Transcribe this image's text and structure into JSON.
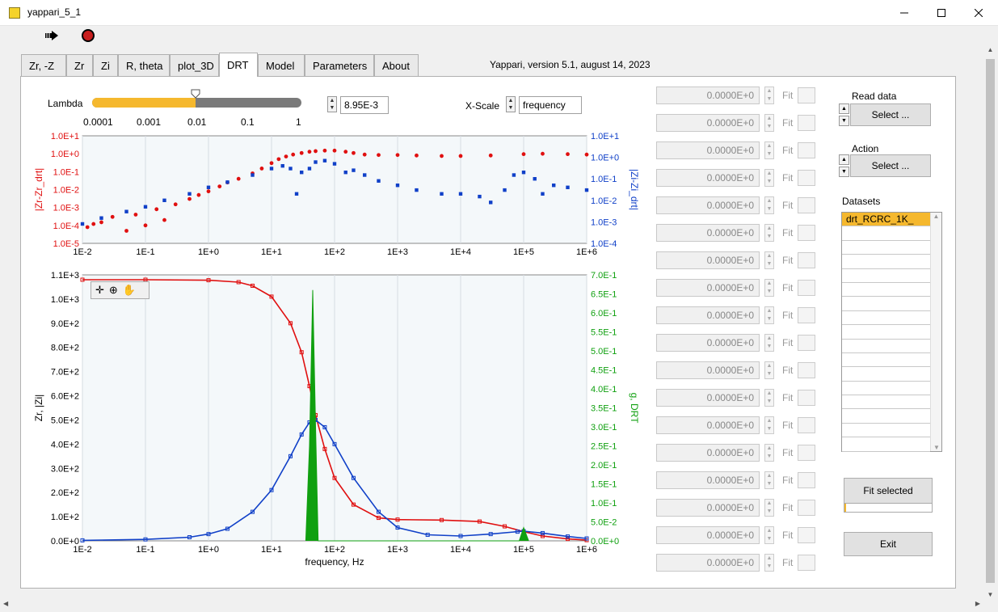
{
  "window": {
    "title": "yappari_5_1"
  },
  "tabs": [
    {
      "label": "Zr, -Z"
    },
    {
      "label": "Zr"
    },
    {
      "label": "Zi"
    },
    {
      "label": "R, theta"
    },
    {
      "label": "plot_3D"
    },
    {
      "label": "DRT"
    },
    {
      "label": "Model"
    },
    {
      "label": "Parameters"
    },
    {
      "label": "About"
    }
  ],
  "active_tab": "DRT",
  "version_text": "Yappari, version 5.1, august 14, 2023",
  "lambda": {
    "label": "Lambda",
    "ticks": [
      "0.0001",
      "0.001",
      "0.01",
      "0.1",
      "1"
    ],
    "slider_value": 0.0095,
    "value": "8.95E-3",
    "accent": "#f5b82e"
  },
  "xscale": {
    "label": "X-Scale",
    "value": "frequency"
  },
  "fit_rows": {
    "value": "0.0000E+0",
    "label": "Fit",
    "count": 18
  },
  "right_panel": {
    "read_data_label": "Read data",
    "read_data_value": "Select ...",
    "action_label": "Action",
    "action_value": "Select ...",
    "datasets_label": "Datasets",
    "datasets": [
      "drt_RCRC_1K_"
    ],
    "fit_selected": "Fit selected",
    "exit": "Exit"
  },
  "colors": {
    "red": "#e01010",
    "blue": "#1040c8",
    "green": "#10a010",
    "plot_bg": "#f4f8fa"
  },
  "chart_data": [
    {
      "type": "scatter",
      "title": "",
      "xlabel": "",
      "ylabel_left": "|Zr-Zr_drt|",
      "ylabel_right": "|Zi-Zi_drt|",
      "x_scale": "log",
      "x_ticks": [
        "1E-2",
        "1E-1",
        "1E+0",
        "1E+1",
        "1E+2",
        "1E+3",
        "1E+4",
        "1E+5",
        "1E+6"
      ],
      "y_left_ticks": [
        "1.0E+1",
        "1.0E+0",
        "1.0E-1",
        "1.0E-2",
        "1.0E-3",
        "1.0E-4",
        "1.0E-5"
      ],
      "y_right_ticks": [
        "1.0E+1",
        "1.0E+0",
        "1.0E-1",
        "1.0E-2",
        "1.0E-3",
        "1.0E-4"
      ],
      "xlim": [
        0.01,
        1000000
      ],
      "ylim_left": [
        1e-05,
        10
      ],
      "ylim_right": [
        0.0001,
        10
      ],
      "series": [
        {
          "name": "|Zr-Zr_drt|",
          "color": "red",
          "axis": "left",
          "points": [
            [
              0.012,
              8e-05
            ],
            [
              0.015,
              0.00012
            ],
            [
              0.02,
              0.00015
            ],
            [
              0.03,
              0.0003
            ],
            [
              0.05,
              5e-05
            ],
            [
              0.07,
              0.0004
            ],
            [
              0.1,
              0.0001
            ],
            [
              0.15,
              0.0008
            ],
            [
              0.2,
              0.0002
            ],
            [
              0.3,
              0.0015
            ],
            [
              0.5,
              0.003
            ],
            [
              0.7,
              0.005
            ],
            [
              1,
              0.008
            ],
            [
              1.5,
              0.015
            ],
            [
              2,
              0.025
            ],
            [
              3,
              0.04
            ],
            [
              5,
              0.08
            ],
            [
              7,
              0.15
            ],
            [
              10,
              0.3
            ],
            [
              13,
              0.5
            ],
            [
              17,
              0.7
            ],
            [
              22,
              0.9
            ],
            [
              30,
              1.1
            ],
            [
              40,
              1.3
            ],
            [
              50,
              1.4
            ],
            [
              70,
              1.5
            ],
            [
              100,
              1.5
            ],
            [
              150,
              1.3
            ],
            [
              200,
              1.1
            ],
            [
              300,
              0.9
            ],
            [
              500,
              0.85
            ],
            [
              1000,
              0.85
            ],
            [
              2000,
              0.8
            ],
            [
              5000,
              0.75
            ],
            [
              10000,
              0.75
            ],
            [
              30000,
              0.8
            ],
            [
              100000,
              0.95
            ],
            [
              200000,
              1.0
            ],
            [
              500000,
              0.95
            ],
            [
              1000000,
              0.9
            ]
          ]
        },
        {
          "name": "|Zi-Zi_drt|",
          "color": "blue",
          "axis": "right",
          "points": [
            [
              0.01,
              0.0008
            ],
            [
              0.02,
              0.0015
            ],
            [
              0.05,
              0.003
            ],
            [
              0.1,
              0.005
            ],
            [
              0.2,
              0.01
            ],
            [
              0.5,
              0.02
            ],
            [
              1,
              0.04
            ],
            [
              2,
              0.07
            ],
            [
              5,
              0.15
            ],
            [
              10,
              0.3
            ],
            [
              15,
              0.4
            ],
            [
              20,
              0.3
            ],
            [
              25,
              0.02
            ],
            [
              30,
              0.2
            ],
            [
              40,
              0.3
            ],
            [
              50,
              0.6
            ],
            [
              70,
              0.7
            ],
            [
              100,
              0.5
            ],
            [
              150,
              0.2
            ],
            [
              200,
              0.25
            ],
            [
              300,
              0.15
            ],
            [
              500,
              0.08
            ],
            [
              1000,
              0.05
            ],
            [
              2000,
              0.03
            ],
            [
              5000,
              0.02
            ],
            [
              10000,
              0.02
            ],
            [
              20000,
              0.015
            ],
            [
              30000,
              0.008
            ],
            [
              50000,
              0.03
            ],
            [
              70000,
              0.15
            ],
            [
              100000,
              0.2
            ],
            [
              150000,
              0.1
            ],
            [
              200000,
              0.02
            ],
            [
              300000,
              0.05
            ],
            [
              500000,
              0.04
            ],
            [
              1000000,
              0.03
            ]
          ]
        }
      ]
    },
    {
      "type": "line",
      "title": "",
      "xlabel": "frequency, Hz",
      "ylabel_left": "Zr, |Zi|",
      "ylabel_right": "g, DRT",
      "x_scale": "log",
      "x_ticks": [
        "1E-2",
        "1E-1",
        "1E+0",
        "1E+1",
        "1E+2",
        "1E+3",
        "1E+4",
        "1E+5",
        "1E+6"
      ],
      "y_left_ticks": [
        "0.0E+0",
        "1.0E+2",
        "2.0E+2",
        "3.0E+2",
        "4.0E+2",
        "5.0E+2",
        "6.0E+2",
        "7.0E+2",
        "8.0E+2",
        "9.0E+2",
        "1.0E+3",
        "1.1E+3"
      ],
      "y_right_ticks": [
        "0.0E+0",
        "5.0E-2",
        "1.0E-1",
        "1.5E-1",
        "2.0E-1",
        "2.5E-1",
        "3.0E-1",
        "3.5E-1",
        "4.0E-1",
        "4.5E-1",
        "5.0E-1",
        "5.5E-1",
        "6.0E-1",
        "6.5E-1",
        "7.0E-1"
      ],
      "xlim": [
        0.01,
        1000000
      ],
      "ylim_left": [
        0,
        1100
      ],
      "ylim_right": [
        0,
        0.7
      ],
      "series": [
        {
          "name": "Zr",
          "color": "red",
          "axis": "left",
          "points": [
            [
              0.01,
              1080
            ],
            [
              0.1,
              1080
            ],
            [
              1,
              1078
            ],
            [
              3,
              1070
            ],
            [
              5,
              1055
            ],
            [
              10,
              1010
            ],
            [
              20,
              900
            ],
            [
              30,
              780
            ],
            [
              40,
              640
            ],
            [
              50,
              520
            ],
            [
              70,
              380
            ],
            [
              100,
              260
            ],
            [
              200,
              150
            ],
            [
              500,
              95
            ],
            [
              1000,
              88
            ],
            [
              5000,
              86
            ],
            [
              20000,
              80
            ],
            [
              50000,
              60
            ],
            [
              100000,
              38
            ],
            [
              200000,
              20
            ],
            [
              500000,
              8
            ],
            [
              1000000,
              3
            ]
          ]
        },
        {
          "name": "|Zi|",
          "color": "blue",
          "axis": "left",
          "points": [
            [
              0.01,
              2
            ],
            [
              0.1,
              6
            ],
            [
              0.5,
              15
            ],
            [
              1,
              28
            ],
            [
              2,
              50
            ],
            [
              5,
              120
            ],
            [
              10,
              210
            ],
            [
              20,
              350
            ],
            [
              30,
              440
            ],
            [
              40,
              490
            ],
            [
              50,
              500
            ],
            [
              70,
              470
            ],
            [
              100,
              400
            ],
            [
              200,
              260
            ],
            [
              500,
              120
            ],
            [
              1000,
              55
            ],
            [
              3000,
              25
            ],
            [
              10000,
              20
            ],
            [
              30000,
              28
            ],
            [
              80000,
              38
            ],
            [
              100000,
              40
            ],
            [
              200000,
              32
            ],
            [
              500000,
              18
            ],
            [
              1000000,
              10
            ]
          ]
        },
        {
          "name": "g, DRT",
          "color": "green",
          "axis": "right",
          "points": [
            [
              35,
              0
            ],
            [
              40,
              0.25
            ],
            [
              45,
              0.66
            ],
            [
              50,
              0.3
            ],
            [
              55,
              0
            ],
            [
              85000,
              0
            ],
            [
              100000,
              0.035
            ],
            [
              120000,
              0
            ]
          ]
        }
      ]
    }
  ]
}
